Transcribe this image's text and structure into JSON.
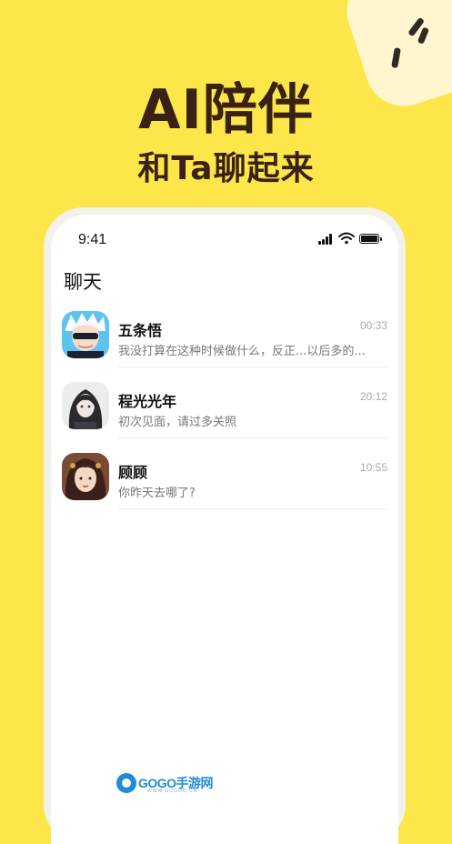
{
  "hero": {
    "title": "AI陪伴",
    "subtitle": "和Ta聊起来"
  },
  "status_bar": {
    "time": "9:41",
    "icons": [
      "signal-icon",
      "wifi-icon",
      "battery-icon"
    ]
  },
  "page": {
    "title": "聊天"
  },
  "chats": [
    {
      "name": "五条悟",
      "time": "00:33",
      "preview": "我没打算在这种时候做什么，反正...以后多的...",
      "avatar": "avatar-gojo"
    },
    {
      "name": "程光光年",
      "time": "20:12",
      "preview": "初次见面，请过多关照",
      "avatar": "avatar-chengguang"
    },
    {
      "name": "顾顾",
      "time": "10:55",
      "preview": "你昨天去哪了?",
      "avatar": "avatar-gugu"
    }
  ],
  "watermark": {
    "text": "GOGO手游网",
    "url": "WWW.GOGOO.CN"
  },
  "colors": {
    "background": "#FCE64A",
    "headline": "#3A2113",
    "phone_frame": "#F2F1EC",
    "time_text": "#A9A9A9",
    "watermark": "#1E8BD8"
  }
}
